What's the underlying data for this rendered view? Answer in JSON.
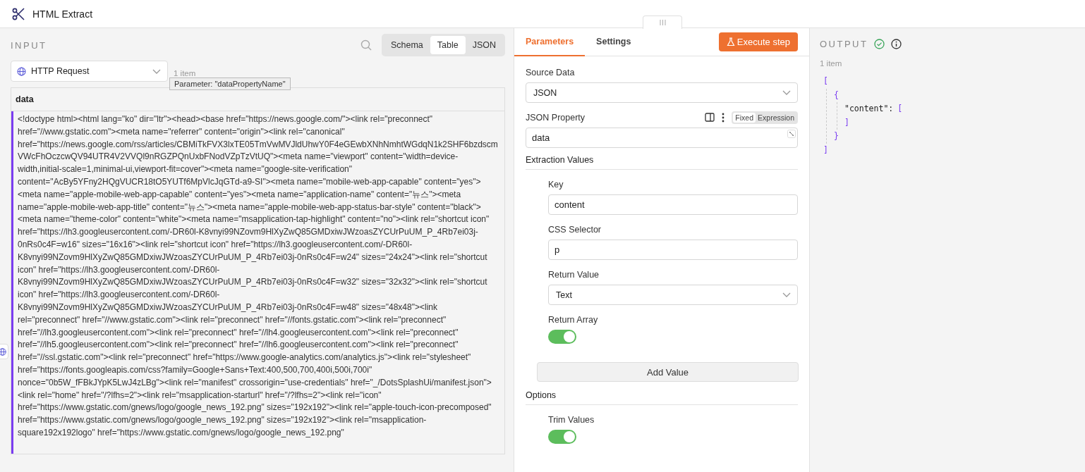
{
  "window": {
    "title": "HTML Extract"
  },
  "input": {
    "title": "INPUT",
    "view_tabs": [
      {
        "label": "Schema",
        "selected": false
      },
      {
        "label": "Table",
        "selected": true
      },
      {
        "label": "JSON",
        "selected": false
      }
    ],
    "node_select": "HTTP Request",
    "item_count": "1 item",
    "tooltip": "Parameter: \"dataPropertyName\"",
    "table": {
      "columns": [
        "data"
      ],
      "rows": [
        [
          "<!doctype html><html lang=\"ko\" dir=\"ltr\"><head><base href=\"https://news.google.com/\"><link rel=\"preconnect\" href=\"//www.gstatic.com\"><meta name=\"referrer\" content=\"origin\"><link rel=\"canonical\" href=\"https://news.google.com/rss/articles/CBMiTkFVX3lxTE05TmVwMVJldUhwY0F4eGEwbXNhNmhtWGdqN1k2SHF6bzdscmVWcFhOczcwQV94UTR4V2VVQl9nRGZPQnUxbFNodVZpTzVtUQ\"><meta name=\"viewport\" content=\"width=device-width,initial-scale=1,minimal-ui,viewport-fit=cover\"><meta name=\"google-site-verification\" content=\"AcBy5YFny2HQgVUCR18tO5YUTf6MpVlcJqGTd-a9-SI\"><meta name=\"mobile-web-app-capable\" content=\"yes\"><meta name=\"apple-mobile-web-app-capable\" content=\"yes\"><meta name=\"application-name\" content=\"뉴스\"><meta name=\"apple-mobile-web-app-title\" content=\"뉴스\"><meta name=\"apple-mobile-web-app-status-bar-style\" content=\"black\"><meta name=\"theme-color\" content=\"white\"><meta name=\"msapplication-tap-highlight\" content=\"no\"><link rel=\"shortcut icon\" href=\"https://lh3.googleusercontent.com/-DR60l-K8vnyi99NZovm9HlXyZwQ85GMDxiwJWzoasZYCUrPuUM_P_4Rb7ei03j-0nRs0c4F=w16\" sizes=\"16x16\"><link rel=\"shortcut icon\" href=\"https://lh3.googleusercontent.com/-DR60l-K8vnyi99NZovm9HlXyZwQ85GMDxiwJWzoasZYCUrPuUM_P_4Rb7ei03j-0nRs0c4F=w24\" sizes=\"24x24\"><link rel=\"shortcut icon\" href=\"https://lh3.googleusercontent.com/-DR60l-K8vnyi99NZovm9HlXyZwQ85GMDxiwJWzoasZYCUrPuUM_P_4Rb7ei03j-0nRs0c4F=w32\" sizes=\"32x32\"><link rel=\"shortcut icon\" href=\"https://lh3.googleusercontent.com/-DR60l-K8vnyi99NZovm9HlXyZwQ85GMDxiwJWzoasZYCUrPuUM_P_4Rb7ei03j-0nRs0c4F=w48\" sizes=\"48x48\"><link rel=\"preconnect\" href=\"//www.gstatic.com\"><link rel=\"preconnect\" href=\"//fonts.gstatic.com\"><link rel=\"preconnect\" href=\"//lh3.googleusercontent.com\"><link rel=\"preconnect\" href=\"//lh4.googleusercontent.com\"><link rel=\"preconnect\" href=\"//lh5.googleusercontent.com\"><link rel=\"preconnect\" href=\"//lh6.googleusercontent.com\"><link rel=\"preconnect\" href=\"//ssl.gstatic.com\"><link rel=\"preconnect\" href=\"https://www.google-analytics.com/analytics.js\"><link rel=\"stylesheet\" href=\"https://fonts.googleapis.com/css?family=Google+Sans+Text:400,500,700,400i,500i,700i\" nonce=\"0b5W_fFBkJYpK5LwJ4zLBg\"><link rel=\"manifest\" crossorigin=\"use-credentials\" href=\"_/DotsSplashUi/manifest.json\"><link rel=\"home\" href=\"/?lfhs=2\"><link rel=\"msapplication-starturl\" href=\"/?lfhs=2\"><link rel=\"icon\" href=\"https://www.gstatic.com/gnews/logo/google_news_192.png\" sizes=\"192x192\"><link rel=\"apple-touch-icon-precomposed\" href=\"https://www.gstatic.com/gnews/logo/google_news_192.png\" sizes=\"192x192\"><link rel=\"msapplication-square192x192logo\" href=\"https://www.gstatic.com/gnews/logo/google_news_192.png\""
        ]
      ]
    }
  },
  "parameters": {
    "tabs": [
      {
        "label": "Parameters",
        "selected": true
      },
      {
        "label": "Settings",
        "selected": false
      }
    ],
    "execute_button": "Execute step",
    "source_data": {
      "label": "Source Data",
      "value": "JSON"
    },
    "json_property": {
      "label": "JSON Property",
      "mode_toggle": [
        {
          "label": "Fixed",
          "selected": true
        },
        {
          "label": "Expression",
          "selected": false
        }
      ],
      "value": "data"
    },
    "extraction_values": {
      "title": "Extraction Values",
      "fields": [
        {
          "kind": "text",
          "label": "Key",
          "value": "content"
        },
        {
          "kind": "text",
          "label": "CSS Selector",
          "value": "p"
        },
        {
          "kind": "select",
          "label": "Return Value",
          "value": "Text"
        },
        {
          "kind": "toggle",
          "label": "Return Array",
          "on": true
        }
      ],
      "add_button": "Add Value"
    },
    "options": {
      "title": "Options",
      "fields": [
        {
          "kind": "toggle",
          "label": "Trim Values",
          "on": true
        }
      ]
    }
  },
  "output": {
    "title": "OUTPUT",
    "item_count": "1 item",
    "json_lines": [
      {
        "bracket": "[",
        "children": [
          {
            "bracket": "{",
            "children": [
              {
                "key": "\"content\":",
                "bracket": "["
              },
              {
                "bracket": "]"
              }
            ]
          },
          {
            "bracket": "}"
          }
        ]
      },
      {
        "bracket": "]"
      }
    ]
  }
}
